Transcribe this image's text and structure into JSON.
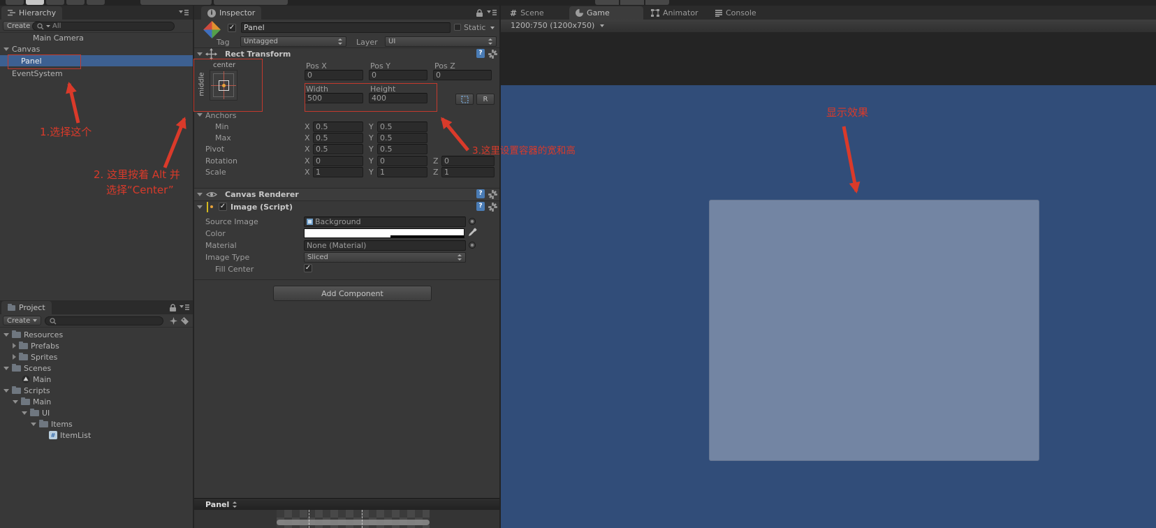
{
  "colors": {
    "annotation_red": "#da3a2a",
    "selection_blue": "#3d6091",
    "game_background": "#314d79",
    "game_panel": "#7385a3"
  },
  "hierarchy": {
    "tab_label": "Hierarchy",
    "create_label": "Create",
    "search_text": "All",
    "items": [
      {
        "label": "Main Camera"
      },
      {
        "label": "Canvas"
      },
      {
        "label": "Panel"
      },
      {
        "label": "EventSystem"
      }
    ]
  },
  "project": {
    "tab_label": "Project",
    "create_label": "Create",
    "items": [
      {
        "label": "Resources"
      },
      {
        "label": "Prefabs"
      },
      {
        "label": "Sprites"
      },
      {
        "label": "Scenes"
      },
      {
        "label": "Main"
      },
      {
        "label": "Scripts"
      },
      {
        "label": "Main"
      },
      {
        "label": "UI"
      },
      {
        "label": "Items"
      },
      {
        "label": "ItemList"
      }
    ]
  },
  "inspector": {
    "tab_label": "Inspector",
    "go_name": "Panel",
    "static_label": "Static",
    "tag_label": "Tag",
    "tag_value": "Untagged",
    "layer_label": "Layer",
    "layer_value": "UI",
    "rect_transform": {
      "title": "Rect Transform",
      "anchor_horizontal": "center",
      "anchor_vertical": "middle",
      "pos_x_label": "Pos X",
      "pos_y_label": "Pos Y",
      "pos_z_label": "Pos Z",
      "pos_x": "0",
      "pos_y": "0",
      "pos_z": "0",
      "width_label": "Width",
      "height_label": "Height",
      "width": "500",
      "height": "400",
      "r_button_label": "R",
      "anchors_label": "Anchors",
      "min_label": "Min",
      "max_label": "Max",
      "pivot_label": "Pivot",
      "x_label": "X",
      "y_label": "Y",
      "z_label": "Z",
      "min_x": "0.5",
      "min_y": "0.5",
      "max_x": "0.5",
      "max_y": "0.5",
      "pivot_x": "0.5",
      "pivot_y": "0.5",
      "rotation_label": "Rotation",
      "rotation_x": "0",
      "rotation_y": "0",
      "rotation_z": "0",
      "scale_label": "Scale",
      "scale_x": "1",
      "scale_y": "1",
      "scale_z": "1"
    },
    "canvas_renderer": {
      "title": "Canvas Renderer"
    },
    "image": {
      "title": "Image (Script)",
      "source_image_label": "Source Image",
      "source_image_value": "Background",
      "color_label": "Color",
      "material_label": "Material",
      "material_value": "None (Material)",
      "image_type_label": "Image Type",
      "image_type_value": "Sliced",
      "fill_center_label": "Fill Center"
    },
    "add_component_label": "Add Component",
    "preview_title": "Panel"
  },
  "game": {
    "tabs": [
      {
        "label": "Scene"
      },
      {
        "label": "Game"
      },
      {
        "label": "Animator"
      },
      {
        "label": "Console"
      }
    ],
    "aspect_value": "1200:750 (1200x750)"
  },
  "annotations": {
    "note1": "1.选择这个",
    "note2_line1": "2. 这里按着 Alt 并",
    "note2_line2": "选择“Center”",
    "note3": "3.这里设置容器的宽和高",
    "note4": "显示效果"
  }
}
